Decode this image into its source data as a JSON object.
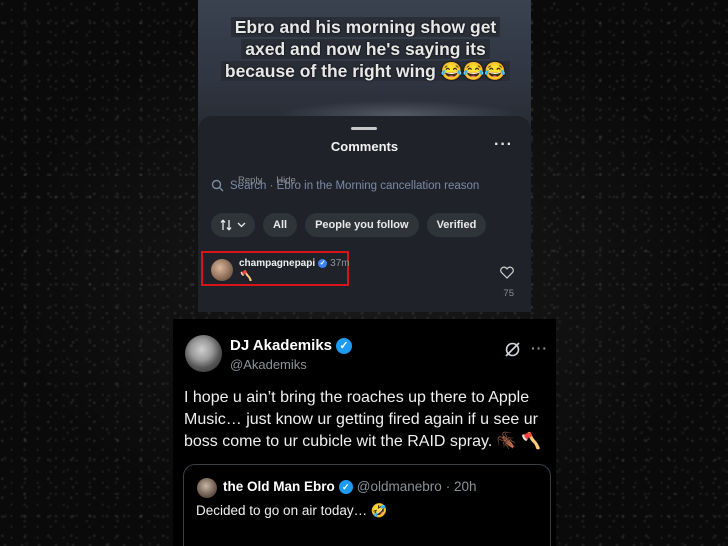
{
  "story": {
    "caption_line1": "Ebro and his morning show get",
    "caption_line2": "axed and now he's saying its",
    "caption_line3": "because of the right wing 😂😂😂"
  },
  "comments_sheet": {
    "title": "Comments",
    "more_icon": "more-horizontal-icon",
    "search_text": "Search · Ebro in the Morning cancellation reason",
    "filters": [
      "All",
      "People you follow",
      "Verified"
    ],
    "comment": {
      "username": "champagnepapi",
      "time": "37m",
      "text": "🪓",
      "reply_label": "Reply",
      "hide_label": "Hide",
      "likes": "75"
    },
    "highlight_color": "#d8141a"
  },
  "tweet": {
    "display_name": "DJ Akademiks",
    "handle": "@Akademiks",
    "text": "I hope u ain’t bring the roaches up there to Apple Music… just know ur getting fired again if u see ur boss come to ur cubicle wit the RAID spray. 🪳 🪓",
    "quote": {
      "display_name": "the Old Man Ebro",
      "handle": "@oldmanebro",
      "time": "· 20h",
      "text": "Decided to go on air today… 🤣"
    },
    "verified_color": "#1d9bf0"
  }
}
